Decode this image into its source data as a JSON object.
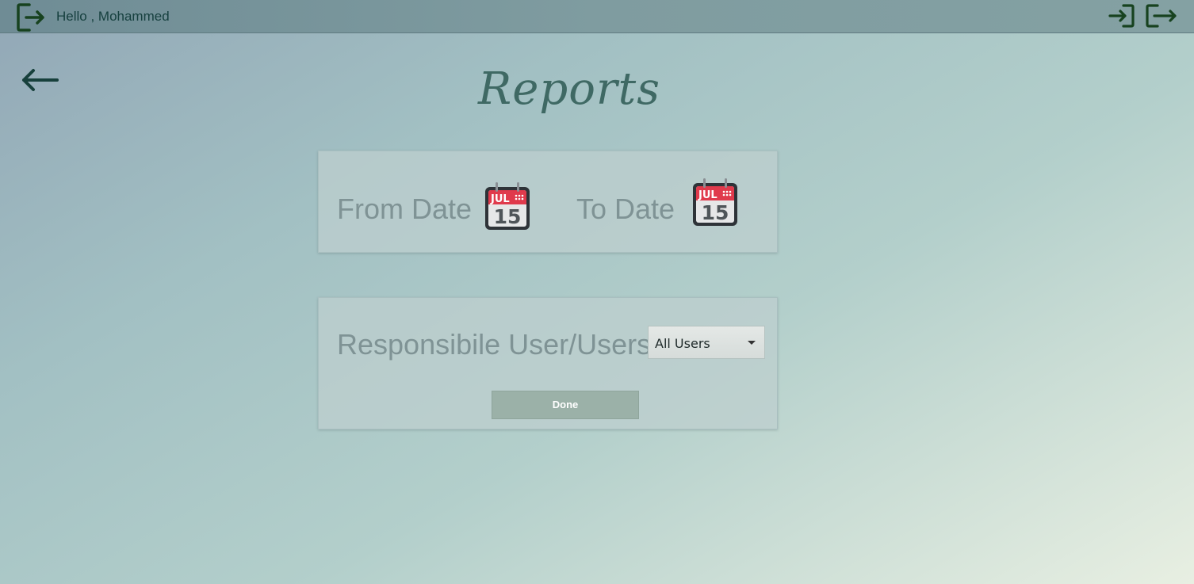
{
  "header": {
    "greeting": "Hello , Mohammed",
    "icons": [
      "logout-icon",
      "login-icon",
      "logout-icon"
    ]
  },
  "page": {
    "title": "Reports",
    "back_icon": "arrow-left-icon"
  },
  "date_panel": {
    "from_label": "From Date",
    "to_label": "To Date",
    "calendar_month": "JUL",
    "calendar_day": "15"
  },
  "users_panel": {
    "label": "Responsibile User/Users",
    "select_value": "All Users",
    "done_label": "Done"
  },
  "colors": {
    "icon_green": "#17421f",
    "title": "#3f6964",
    "calendar_red": "#e03a4c",
    "button": "#9bb1a8"
  }
}
